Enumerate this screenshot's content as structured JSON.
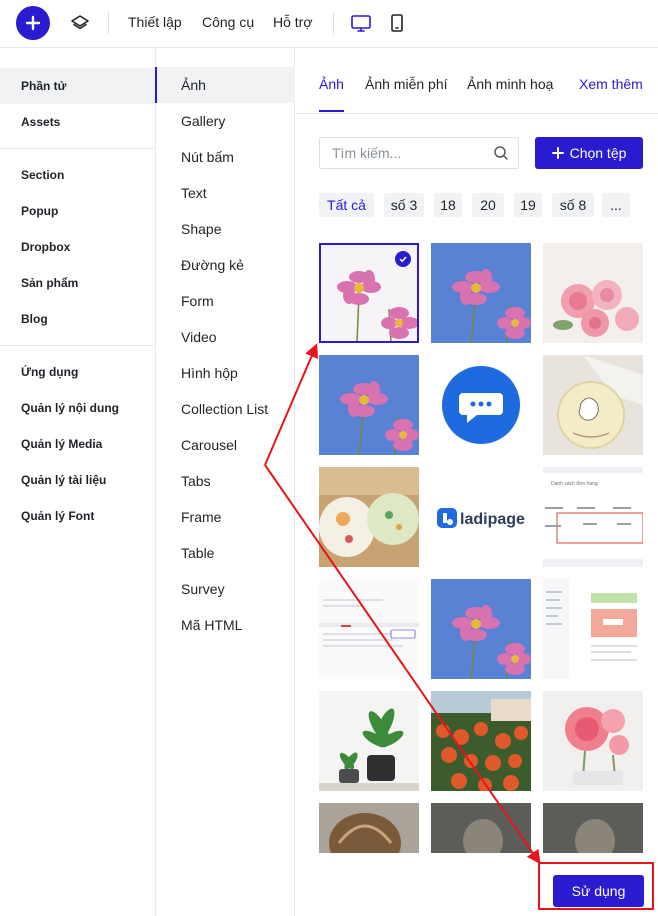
{
  "topbar": {
    "menu": [
      "Thiết lập",
      "Công cụ",
      "Hỗ trợ"
    ],
    "icons": [
      "plus-icon",
      "layers-icon",
      "desktop-icon",
      "mobile-icon"
    ]
  },
  "left_menu": {
    "group1": [
      "Phần tử",
      "Assets"
    ],
    "group2": [
      "Section",
      "Popup",
      "Dropbox",
      "Sản phẩm",
      "Blog"
    ],
    "group3": [
      "Ứng dụng",
      "Quản lý nội dung",
      "Quản lý Media",
      "Quản lý tài liệu",
      "Quản lý Font"
    ]
  },
  "middle_menu": [
    "Ảnh",
    "Gallery",
    "Nút bấm",
    "Text",
    "Shape",
    "Đường kẻ",
    "Form",
    "Video",
    "Hình hộp",
    "Collection List",
    "Carousel",
    "Tabs",
    "Frame",
    "Table",
    "Survey",
    "Mã HTML"
  ],
  "panel": {
    "tabs": [
      "Ảnh",
      "Ảnh miễn phí",
      "Ảnh minh hoạ"
    ],
    "more_link": "Xem thêm",
    "search_placeholder": "Tìm kiếm...",
    "choose_file_label": "Chọn tệp",
    "filters": [
      "Tất cả",
      "số 3",
      "18",
      "20",
      "19",
      "số 8",
      "..."
    ],
    "use_button": "Sử dụng",
    "logo_text": "ladipage",
    "thumb_doc_heading": "Danh sách đơn hàng"
  },
  "colors": {
    "accent": "#2a1bd1",
    "annotation": "#e8141a",
    "chip_bg": "#f1f2f4"
  }
}
